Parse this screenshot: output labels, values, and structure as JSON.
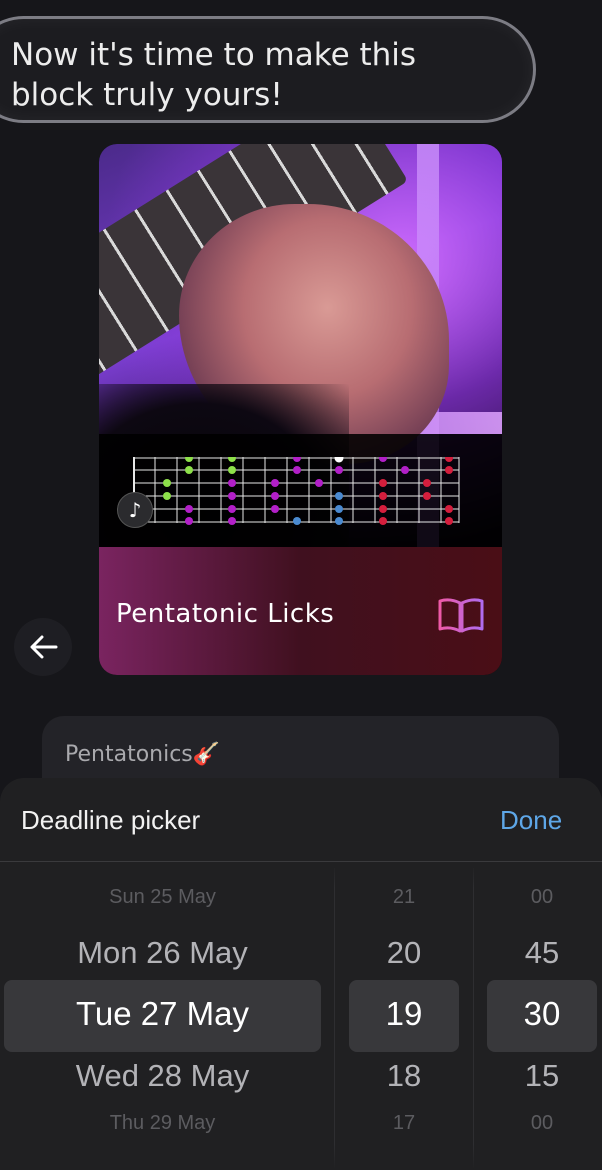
{
  "chat": {
    "message_lines": [
      "Now it's time to make this",
      "block truly yours!"
    ]
  },
  "card": {
    "title": "Pentatonic Licks",
    "book_icon_color": "#d35cc8",
    "tiktok_icon": "♪"
  },
  "input": {
    "value": "Pentatonics🎸"
  },
  "picker": {
    "title": "Deadline picker",
    "done_label": "Done",
    "days": [
      "Sun 25 May",
      "Mon 26 May",
      "Tue 27 May",
      "Wed 28 May",
      "Thu 29 May"
    ],
    "hours": [
      "21",
      "20",
      "19",
      "18",
      "17"
    ],
    "minutes": [
      "00",
      "45",
      "30",
      "15",
      "00"
    ],
    "selected_index": 2
  },
  "colors": {
    "accent_done": "#5ea7e8",
    "sheet_bg": "#202022"
  }
}
